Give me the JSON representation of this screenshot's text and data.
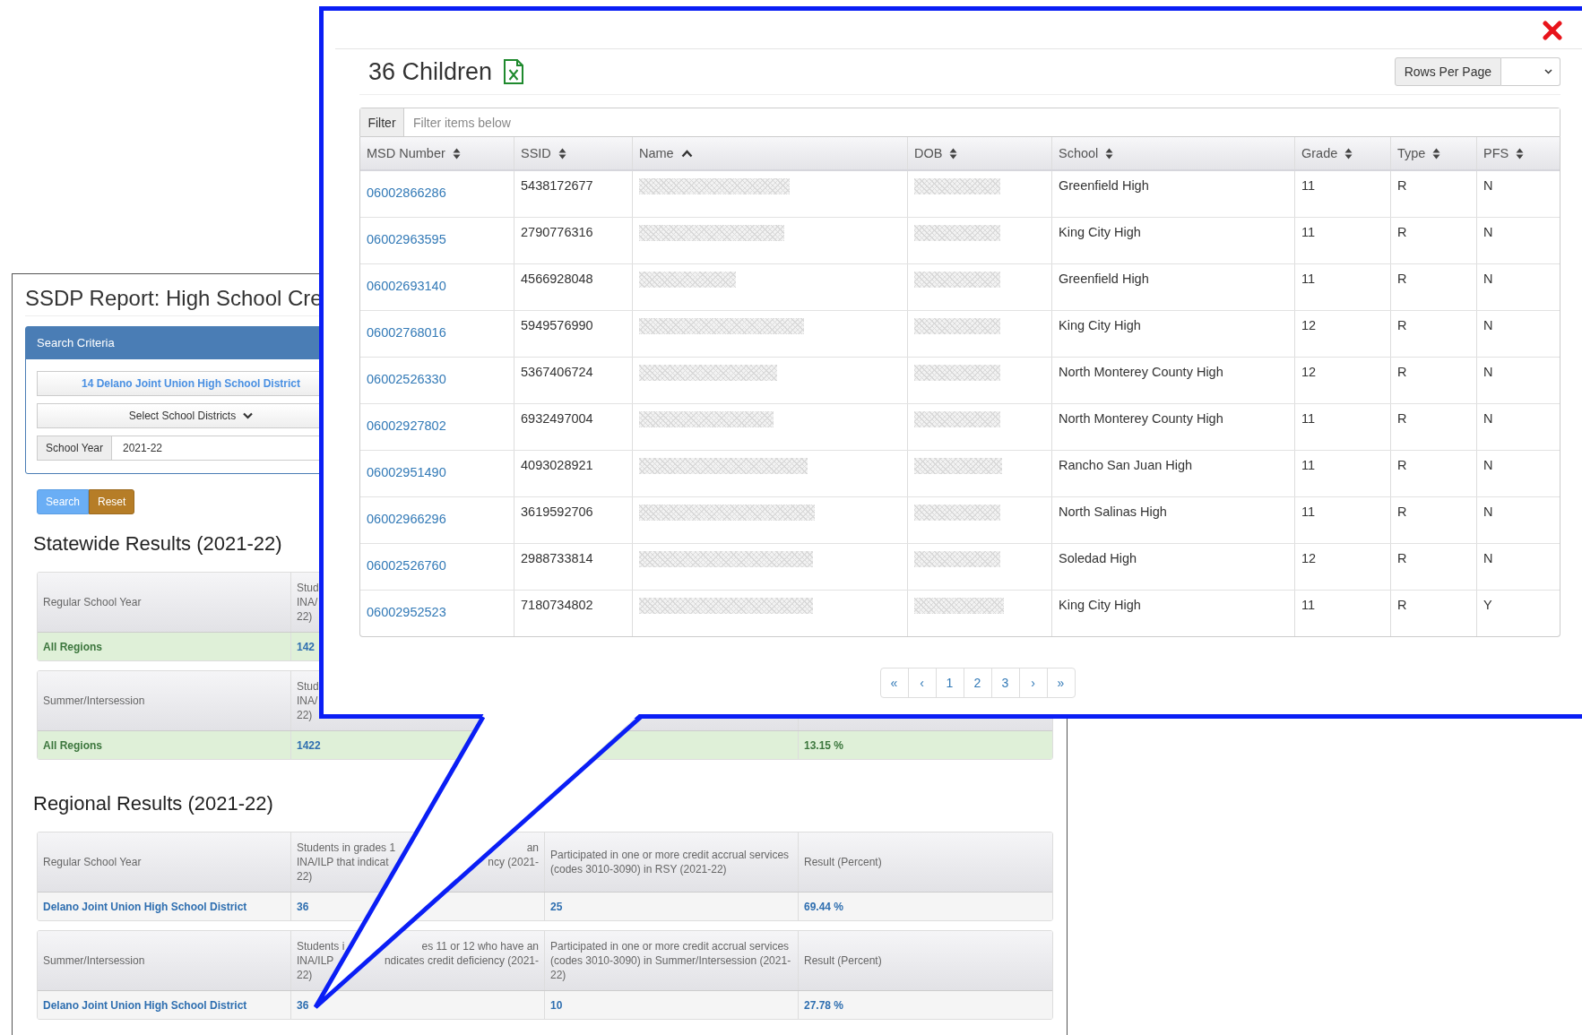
{
  "report": {
    "title": "SSDP Report: High School Cre",
    "search_criteria": {
      "title": "Search Criteria",
      "district_button": "14 Delano Joint Union High School District",
      "districts_dropdown": "Select School Districts",
      "school_year": {
        "label": "School Year",
        "value": "2021-22"
      }
    },
    "buttons": [
      {
        "label": "Search",
        "kind": "primary"
      },
      {
        "label": "Reset",
        "kind": "warning"
      }
    ],
    "sections": [
      {
        "title": "Statewide Results (2021-22)",
        "tables": [
          {
            "headers": [
              {
                "text": "Regular School Year"
              },
              {
                "kind": "cut",
                "lines": [
                  [
                    "Stud"
                  ],
                  [
                    "INA/"
                  ],
                  [
                    "22)"
                  ]
                ]
              }
            ],
            "row": {
              "highlight": true,
              "cells": [
                {
                  "text": "All Regions",
                  "kind": "label"
                },
                {
                  "text": "142",
                  "kind": "count"
                },
                null,
                null
              ]
            }
          },
          {
            "headers": [
              {
                "text": "Summer/Intersession"
              },
              {
                "kind": "cut",
                "lines": [
                  [
                    "Stud"
                  ],
                  [
                    "INA/"
                  ],
                  [
                    "22)"
                  ]
                ]
              }
            ],
            "row": {
              "highlight": true,
              "cells": [
                {
                  "text": "All Regions",
                  "kind": "label"
                },
                {
                  "text": "1422",
                  "kind": "count"
                },
                null,
                {
                  "text": "13.15 %",
                  "kind": "percent"
                }
              ]
            }
          }
        ]
      },
      {
        "title": "Regional Results (2021-22)",
        "tables": [
          {
            "headers": [
              {
                "text": "Regular School Year"
              },
              {
                "kind": "cut",
                "lines": [
                  [
                    "Students in grades 1",
                    "an"
                  ],
                  [
                    "INA/ILP that indicat",
                    "ncy (2021-"
                  ],
                  [
                    "22)"
                  ]
                ]
              },
              {
                "text": "Participated in one or more credit accrual services (codes 3010-3090) in RSY (2021-22)"
              },
              {
                "text": "Result (Percent)"
              }
            ],
            "row": {
              "highlight": false,
              "cells": [
                {
                  "text": "Delano Joint Union High School District",
                  "kind": "label"
                },
                {
                  "text": "36",
                  "kind": "count"
                },
                {
                  "text": "25",
                  "kind": "count"
                },
                {
                  "text": "69.44 %",
                  "kind": "percent"
                }
              ]
            }
          },
          {
            "headers": [
              {
                "text": "Summer/Intersession"
              },
              {
                "kind": "cut",
                "lines": [
                  [
                    "Students i",
                    "es 11 or 12 who have an"
                  ],
                  [
                    "INA/ILP",
                    "ndicates credit deficiency (2021-"
                  ],
                  [
                    "22)"
                  ]
                ]
              },
              {
                "text": "Participated in one or more credit accrual services (codes 3010-3090) in Summer/Intersession (2021-22)"
              },
              {
                "text": "Result (Percent)"
              }
            ],
            "row": {
              "highlight": false,
              "cells": [
                {
                  "text": "Delano Joint Union High School District",
                  "kind": "label"
                },
                {
                  "text": "36",
                  "kind": "count"
                },
                {
                  "text": "10",
                  "kind": "count"
                },
                {
                  "text": "27.78 %",
                  "kind": "percent"
                }
              ]
            }
          }
        ]
      }
    ]
  },
  "dialog": {
    "title": "36 Children",
    "rows_per_page": {
      "label": "Rows Per Page"
    },
    "filter": {
      "label": "Filter",
      "placeholder": "Filter items below"
    },
    "columns": [
      {
        "label": "MSD Number",
        "sorted_ascending": false
      },
      {
        "label": "SSID",
        "sorted_ascending": false
      },
      {
        "label": "Name",
        "sorted_ascending": true
      },
      {
        "label": "DOB",
        "sorted_ascending": false
      },
      {
        "label": "School",
        "sorted_ascending": false
      },
      {
        "label": "Grade",
        "sorted_ascending": false
      },
      {
        "label": "Type",
        "sorted_ascending": false
      },
      {
        "label": "PFS",
        "sorted_ascending": false
      }
    ],
    "rows": [
      {
        "msd_number": "06002866286",
        "ssid": "5438172677",
        "school": "Greenfield High",
        "grade": "11",
        "type": "R",
        "pfs": "N"
      },
      {
        "msd_number": "06002963595",
        "ssid": "2790776316",
        "school": "King City High",
        "grade": "11",
        "type": "R",
        "pfs": "N"
      },
      {
        "msd_number": "06002693140",
        "ssid": "4566928048",
        "school": "Greenfield High",
        "grade": "11",
        "type": "R",
        "pfs": "N"
      },
      {
        "msd_number": "06002768016",
        "ssid": "5949576990",
        "school": "King City High",
        "grade": "12",
        "type": "R",
        "pfs": "N"
      },
      {
        "msd_number": "06002526330",
        "ssid": "5367406724",
        "school": "North Monterey County High",
        "grade": "12",
        "type": "R",
        "pfs": "N"
      },
      {
        "msd_number": "06002927802",
        "ssid": "6932497004",
        "school": "North Monterey County High",
        "grade": "11",
        "type": "R",
        "pfs": "N"
      },
      {
        "msd_number": "06002951490",
        "ssid": "4093028921",
        "school": "Rancho San Juan High",
        "grade": "11",
        "type": "R",
        "pfs": "N"
      },
      {
        "msd_number": "06002966296",
        "ssid": "3619592706",
        "school": "North Salinas High",
        "grade": "11",
        "type": "R",
        "pfs": "N"
      },
      {
        "msd_number": "06002526760",
        "ssid": "2988733814",
        "school": "Soledad High",
        "grade": "12",
        "type": "R",
        "pfs": "N"
      },
      {
        "msd_number": "06002952523",
        "ssid": "7180734802",
        "school": "King City High",
        "grade": "11",
        "type": "R",
        "pfs": "Y"
      }
    ],
    "pagination": [
      "«",
      "‹",
      "1",
      "2",
      "3",
      "›",
      "»"
    ]
  }
}
